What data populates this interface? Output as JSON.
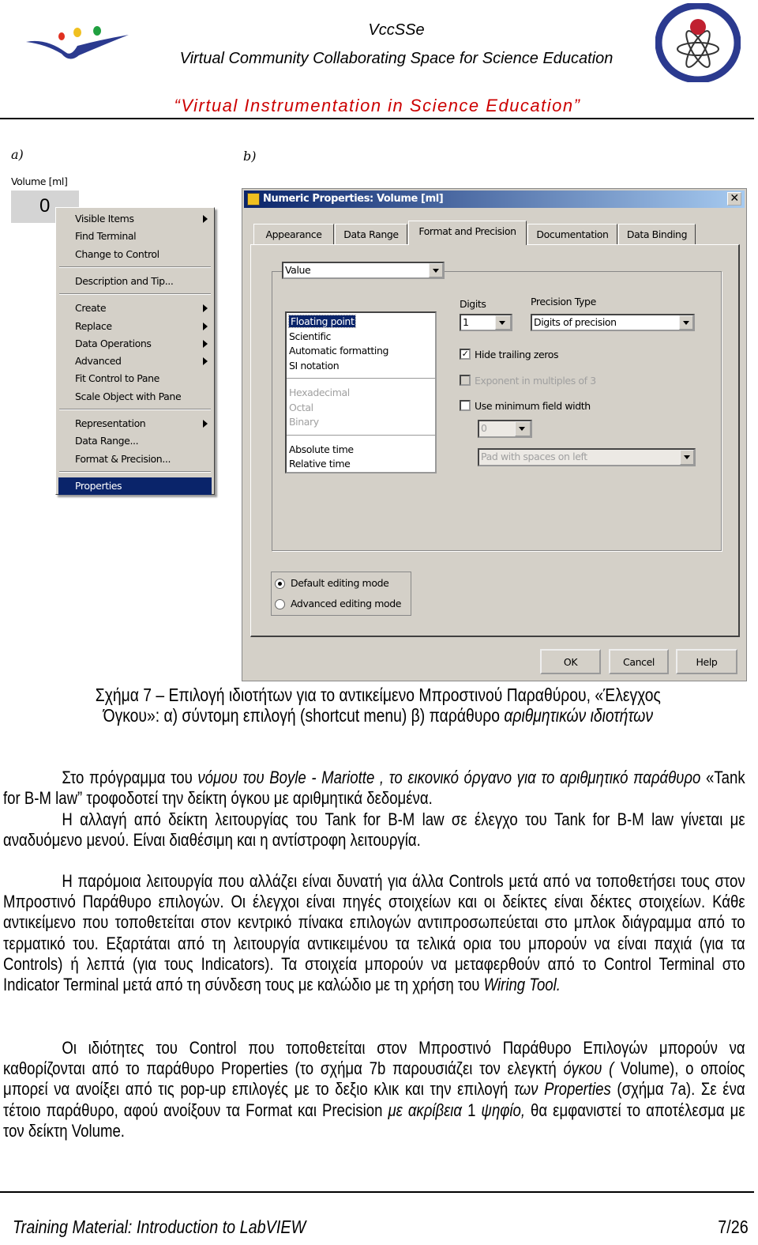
{
  "header": {
    "brand": "VccSSe",
    "subtitle": "Virtual Community Collaborating Space for Science Education",
    "tagline": "“Virtual Instrumentation in Science Education”",
    "accent": "#cc0000"
  },
  "figure": {
    "label_a": "a)",
    "label_b": "b)",
    "control": {
      "label": "Volume [ml]",
      "value": "0"
    },
    "context_menu": {
      "groups": [
        [
          {
            "label": "Visible Items",
            "submenu": true
          },
          {
            "label": "Find Terminal"
          },
          {
            "label": "Change to Control"
          }
        ],
        [
          {
            "label": "Description and Tip..."
          }
        ],
        [
          {
            "label": "Create",
            "submenu": true
          },
          {
            "label": "Replace",
            "submenu": true
          },
          {
            "label": "Data Operations",
            "submenu": true
          },
          {
            "label": "Advanced",
            "submenu": true
          },
          {
            "label": "Fit Control to Pane"
          },
          {
            "label": "Scale Object with Pane"
          }
        ],
        [
          {
            "label": "Representation",
            "submenu": true
          },
          {
            "label": "Data Range..."
          },
          {
            "label": "Format & Precision..."
          }
        ],
        [
          {
            "label": "Properties",
            "selected": true
          }
        ]
      ]
    },
    "dialog": {
      "title": "Numeric Properties: Volume [ml]",
      "tabs": [
        "Appearance",
        "Data Range",
        "Format and Precision",
        "Documentation",
        "Data Binding"
      ],
      "active_tab": "Format and Precision",
      "value_select": "Value",
      "format_list": {
        "group1": [
          "Floating point",
          "Scientific",
          "Automatic formatting",
          "SI notation"
        ],
        "group2": [
          "Hexadecimal",
          "Octal",
          "Binary"
        ],
        "group3": [
          "Absolute time",
          "Relative time"
        ],
        "selected": "Floating point"
      },
      "digits_label": "Digits",
      "digits_value": "1",
      "precision_label": "Precision Type",
      "precision_value": "Digits of precision",
      "hide_trailing": {
        "label": "Hide trailing zeros",
        "checked": true
      },
      "exponent3": {
        "label": "Exponent in multiples of 3",
        "checked": false,
        "disabled": true
      },
      "min_width": {
        "label": "Use minimum field width",
        "checked": false
      },
      "min_width_value": "0",
      "pad_value": "Pad with spaces on left",
      "mode_default": "Default editing mode",
      "mode_advanced": "Advanced editing mode",
      "mode_selected": "Default editing mode",
      "ok": "OK",
      "cancel": "Cancel",
      "help": "Help"
    }
  },
  "caption": {
    "line1": "Σχήμα 7  – Επιλογή ιδιοτήτων για το αντικείμενο Μπροστινού Παραθύρου, «Έλεγχος",
    "line2a": "Όγκου»: α) σύντομη επιλογή (shortcut menu) β)  παράθυρο ",
    "line2b": "αριθμητικών  ιδιοτήτων"
  },
  "paragraphs": [
    [
      {
        "t": "Στο  πρόγραμμα του "
      },
      {
        "t": "νόμου του Boyle - Mariotte , το εικονικό όργανο για το αριθμητικό παράθυρο",
        "i": true
      },
      {
        "t": " «Tank for B-M law” τροφοδοτεί την δείκτη όγκου με αριθμητικά δεδομένα."
      }
    ],
    [
      {
        "t": "Η αλλαγή από  δείκτη λειτουργίας του Tank for B-M law σε έλεγχο του Tank for B-M law γίνεται με αναδυόμενο μενού. Είναι διαθέσιμη και η αντίστροφη λειτουργία."
      }
    ],
    [
      {
        "t": "Η παρόμοια λειτουργία που αλλάζει είναι δυνατή για άλλα Controls μετά από να τοποθετήσει τους στον Μπροστινό Παράθυρο  επιλογών. Οι έλεγχοι είναι πηγές στοιχείων και οι δείκτες είναι δέκτες στοιχείων. Κάθε αντικείμενο που τοποθετείται στον κεντρικό πίνακα επιλογών αντιπροσωπεύεται στο μπλοκ διάγραμμα  από το τερματικό του. Εξαρτάται από τη λειτουργία αντικειμένου τα τελικά ορια του μπορούν να είναι παχιά (για τα Controls) ή λεπτά (για τους Indicators). Τα στοιχεία μπορούν να μεταφερθούν από το Control Terminal στο Indicator Terminal  μετά από τη σύνδεση τους με  καλώδιο με τη χρήση του  "
      },
      {
        "t": "Wiring Tool.",
        "i": true
      }
    ],
    [
      {
        "t": "Οι ιδιότητες του Control που τοποθετείται στον Μπροστινό Παράθυρο Επιλογών μπορούν να καθορίζονται από το παράθυρο Properties  (το σχήμα  7b  παρουσιάζει τον ελεγκτή "
      },
      {
        "t": "όγκου (",
        "i": true
      },
      {
        "t": " Volume), ο οποίος μπορεί να ανοίξει από τις pop-up επιλογές με το δεξιο κλικ και την επιλογή "
      },
      {
        "t": "των Properties",
        "i": true
      },
      {
        "t": " (σχήμα 7a). Σε ένα τέτοιο παράθυρο, αφού ανοίξουν τα Format και Precision  "
      },
      {
        "t": "με  ακρίβεια",
        "i": true
      },
      {
        "t": " 1 "
      },
      {
        "t": "ψηφίο,",
        "i": true
      },
      {
        "t": "  θα εμφανιστεί το αποτέλεσμα  με τον δείκτη Volume."
      }
    ]
  ],
  "footer": {
    "title": "Training Material: Introduction to LabVIEW",
    "page": "7/26"
  }
}
